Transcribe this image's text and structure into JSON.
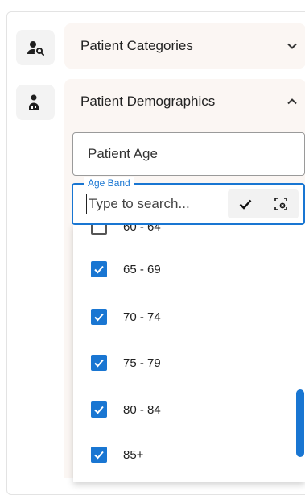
{
  "sections": {
    "categories": {
      "label": "Patient Categories",
      "expanded": false
    },
    "demographics": {
      "label": "Patient Demographics",
      "expanded": true
    }
  },
  "fields": {
    "patient_age": {
      "value": "Patient Age"
    },
    "age_band": {
      "legend": "Age Band",
      "placeholder": "Type to search...",
      "value": ""
    }
  },
  "options": [
    {
      "label": "60 - 64",
      "checked": false
    },
    {
      "label": "65 - 69",
      "checked": true
    },
    {
      "label": "70 - 74",
      "checked": true
    },
    {
      "label": "75 - 79",
      "checked": true
    },
    {
      "label": "80 - 84",
      "checked": true
    },
    {
      "label": "85+",
      "checked": true
    }
  ],
  "colors": {
    "accent": "#1976d2",
    "section_bg": "#fbf6f3",
    "icon_bg": "#f3f3f3"
  },
  "icons": {
    "categories": "person-search-icon",
    "demographics": "person-info-icon",
    "confirm": "check-icon",
    "clear": "clear-selection-icon"
  }
}
